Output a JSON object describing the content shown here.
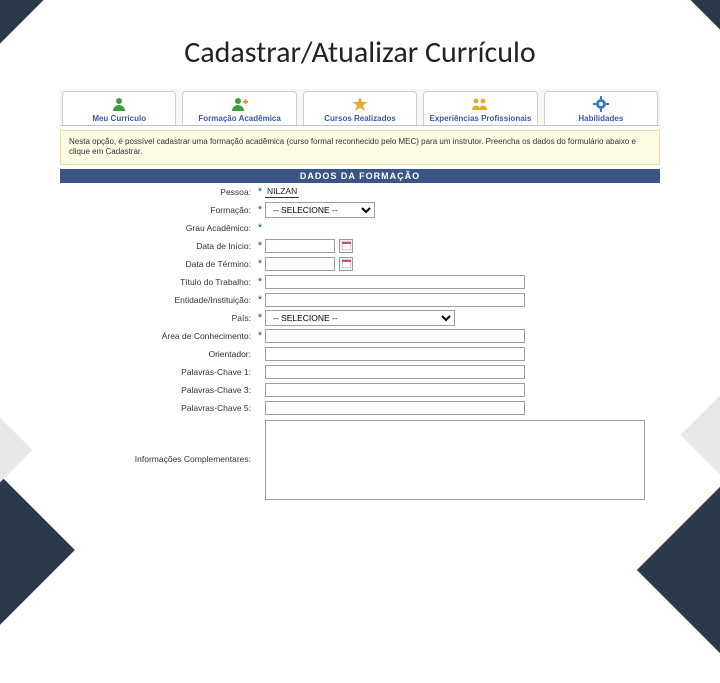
{
  "page_title": "Cadastrar/Atualizar Currículo",
  "tabs": [
    {
      "label": "Meu Currículo",
      "icon": "person-green"
    },
    {
      "label": "Formação Acadêmica",
      "icon": "person-add"
    },
    {
      "label": "Cursos Realizados",
      "icon": "star-orange"
    },
    {
      "label": "Experiências Profissionais",
      "icon": "people-orange"
    },
    {
      "label": "Habilidades",
      "icon": "gear-blue"
    }
  ],
  "help_text": "Nesta opção, é possível cadastrar uma formação acadêmica (curso formal reconhecido pelo MEC) para um instrutor. Preencha os dados do formulário abaixo e clique em Cadastrar.",
  "section_header": "DADOS DA FORMAÇÃO",
  "fields": {
    "pessoa": {
      "label": "Pessoa:",
      "value": "NILZAN"
    },
    "formacao": {
      "label": "Formação:",
      "selected": "-- SELECIONE --"
    },
    "grau_academico": {
      "label": "Grau Acadêmico:"
    },
    "data_inicio": {
      "label": "Data de Início:"
    },
    "data_termino": {
      "label": "Data de Término:"
    },
    "titulo_trabalho": {
      "label": "Título do Trabalho:"
    },
    "entidade_instituicao": {
      "label": "Entidade/Instituição:"
    },
    "pais": {
      "label": "País:",
      "selected": "-- SELECIONE --"
    },
    "area_conhecimento": {
      "label": "Área de Conhecimento:"
    },
    "orientador": {
      "label": "Orientador:"
    },
    "palavra_chave_1": {
      "label": "Palavras-Chave 1:"
    },
    "palavra_chave_3": {
      "label": "Palavras-Chave 3:"
    },
    "palavra_chave_5": {
      "label": "Palavras-Chave 5:"
    },
    "info_complementares": {
      "label": "Informações Complementares:"
    }
  },
  "select_options": {
    "default_option": "-- SELECIONE --"
  }
}
